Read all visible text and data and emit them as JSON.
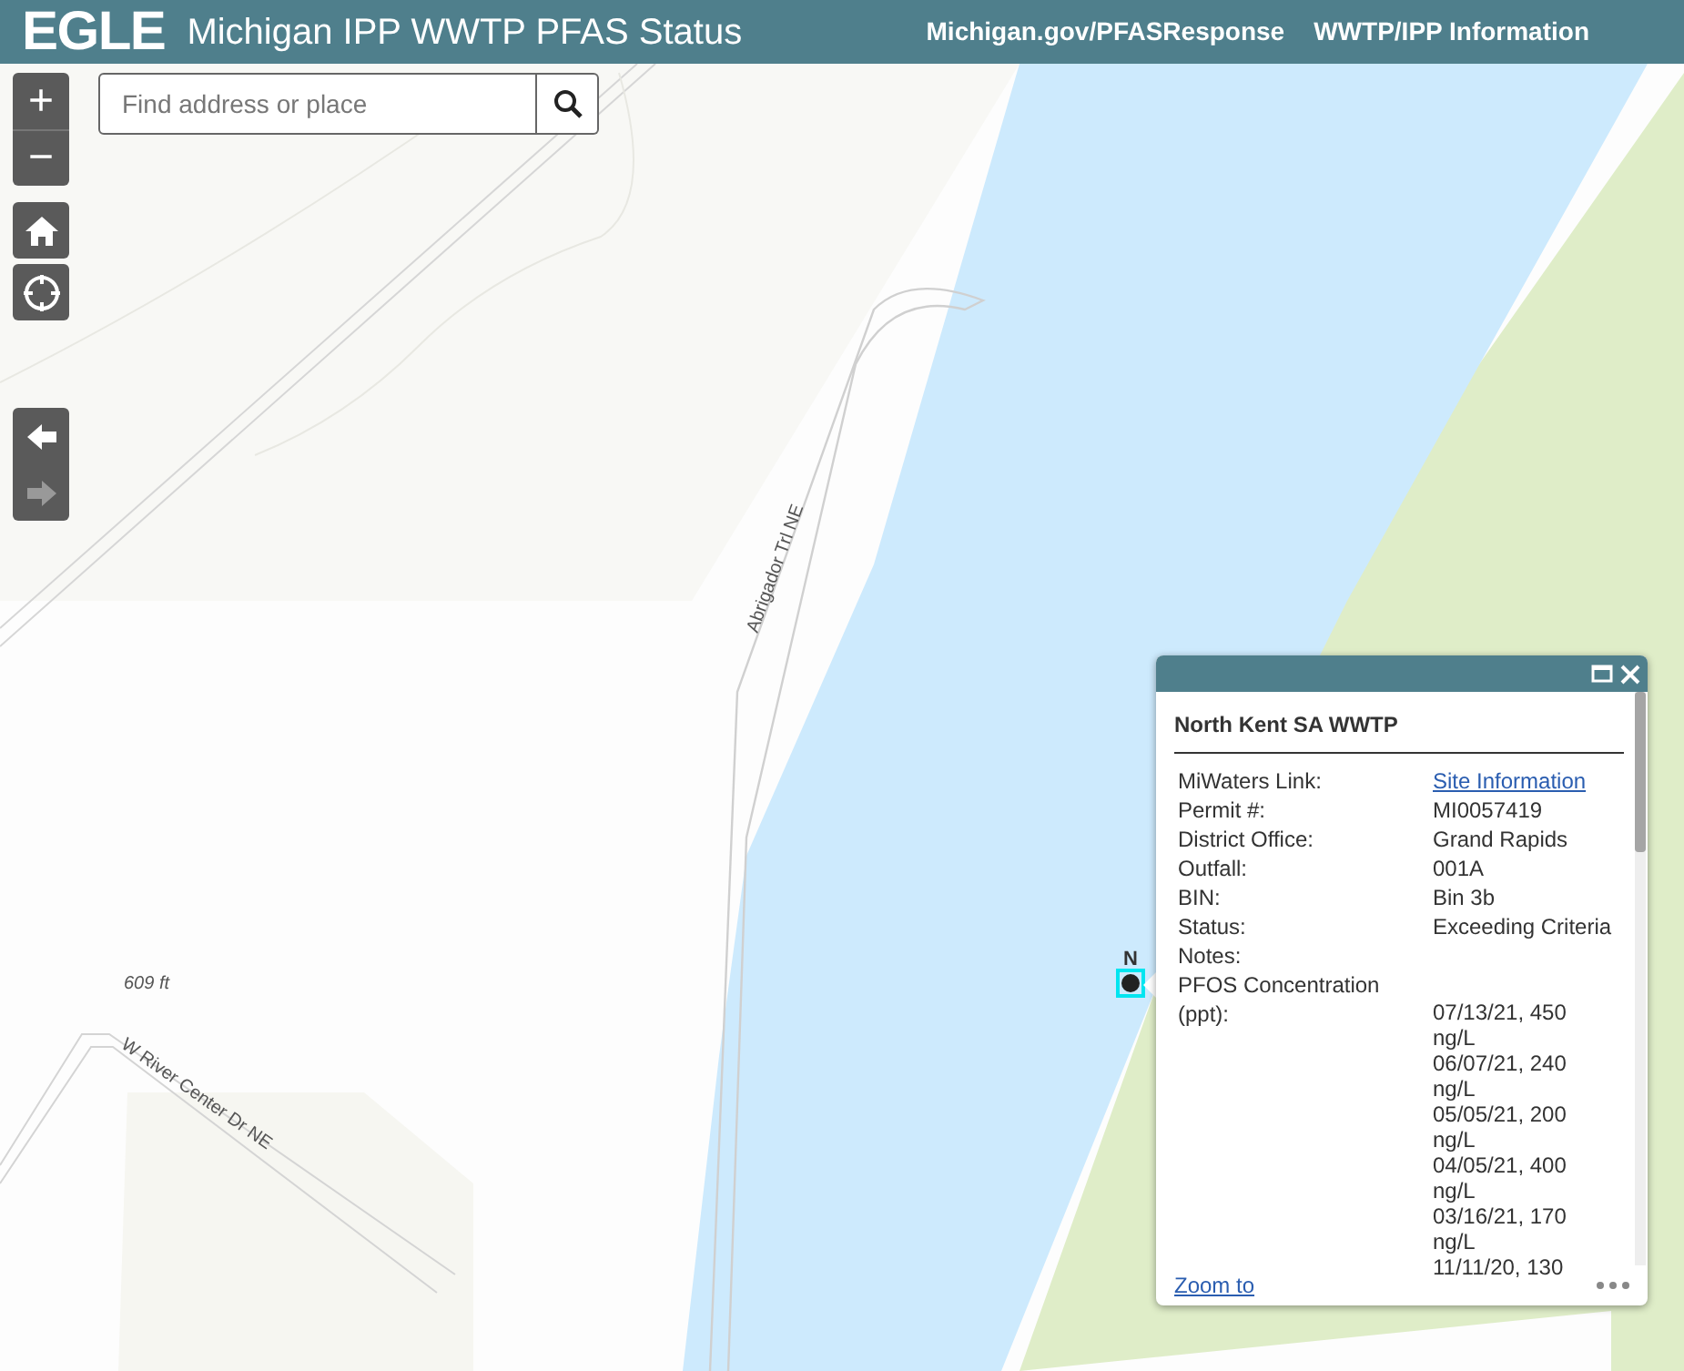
{
  "header": {
    "logo": "EGLE",
    "title": "Michigan IPP WWTP PFAS Status",
    "links": [
      "Michigan.gov/PFASResponse",
      "WWTP/IPP Information"
    ]
  },
  "search": {
    "placeholder": "Find address or place"
  },
  "zoom_controls": {
    "zoom_in": "+",
    "zoom_out": "−"
  },
  "history": {
    "back_disabled": false,
    "forward_disabled": true
  },
  "map_labels": {
    "road_1": "Abrigador Trl NE",
    "road_2": "W River Center Dr NE",
    "elevation": "609 ft",
    "marker_label": "N"
  },
  "popup": {
    "title": "North Kent SA WWTP",
    "fields": [
      {
        "label": "MiWaters Link:",
        "value": "Site Information",
        "kind": "link"
      },
      {
        "label": "Permit #:",
        "value": "MI0057419",
        "kind": "text"
      },
      {
        "label": "District Office:",
        "value": "Grand Rapids",
        "kind": "text"
      },
      {
        "label": "Outfall:",
        "value": "001A",
        "kind": "text"
      },
      {
        "label": "BIN:",
        "value": "Bin 3b",
        "kind": "text"
      },
      {
        "label": "Status:",
        "value": "Exceeding Criteria",
        "kind": "text"
      },
      {
        "label": "Notes:",
        "kind": "text"
      }
    ],
    "concentration": {
      "label": "PFOS Concentration (ppt):",
      "readings": [
        {
          "sample": "07/13/21, 450",
          "unit": "ng/L"
        },
        {
          "sample": "06/07/21, 240",
          "unit": "ng/L"
        },
        {
          "sample": "05/05/21, 200",
          "unit": "ng/L"
        },
        {
          "sample": "04/05/21, 400",
          "unit": "ng/L"
        },
        {
          "sample": "03/16/21, 170",
          "unit": "ng/L"
        },
        {
          "sample": "11/11/20, 130"
        }
      ]
    },
    "footer_link": "Zoom to"
  }
}
